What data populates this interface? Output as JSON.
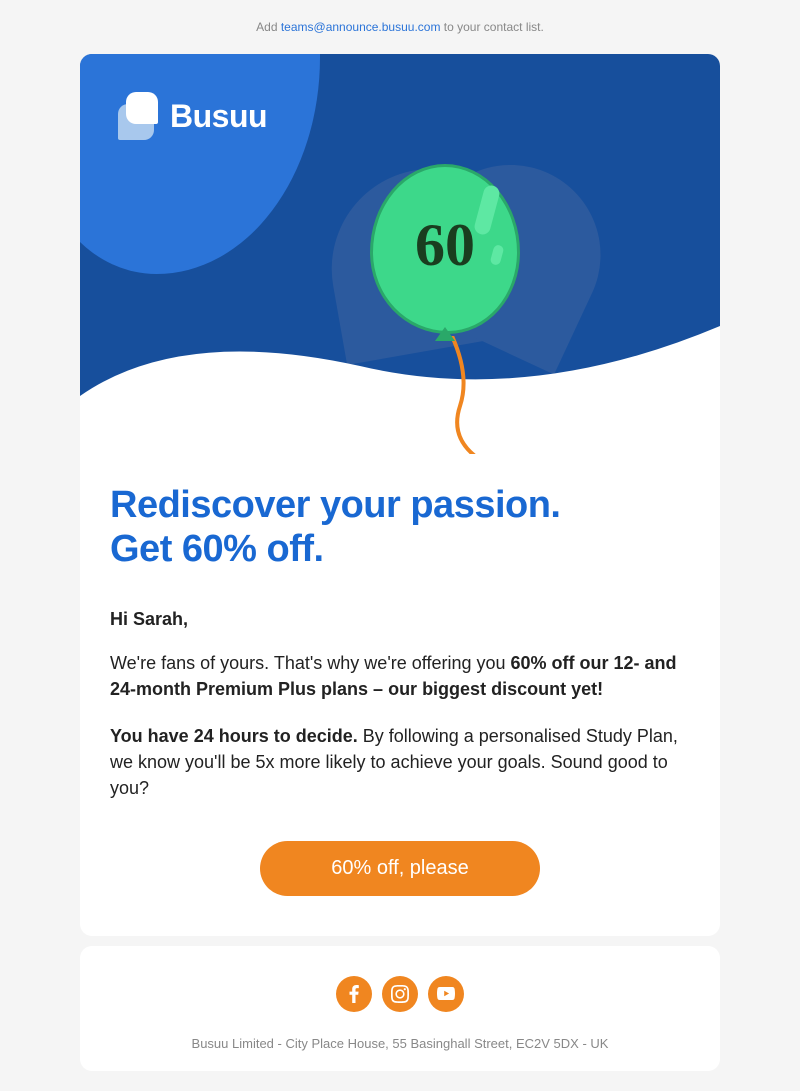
{
  "notice": {
    "prefix": "Add ",
    "email": "teams@announce.busuu.com",
    "suffix": " to your contact list."
  },
  "logo": {
    "name": "Busuu"
  },
  "balloon": {
    "number": "60"
  },
  "headline": {
    "line1": "Rediscover your passion.",
    "line2": "Get 60% off."
  },
  "greeting": "Hi Sarah,",
  "paragraphs": {
    "p1_prefix": "We're fans of yours. That's why we're offering you ",
    "p1_bold": "60% off our 12- and 24-month Premium Plus plans – our biggest discount yet!",
    "p2_bold": "You have 24 hours to decide.",
    "p2_suffix": " By following a personalised Study Plan, we know you'll be 5x more likely to achieve your goals. Sound good to you?"
  },
  "cta": {
    "label": "60% off, please"
  },
  "footer": {
    "address": "Busuu Limited - City Place House, 55 Basinghall Street, EC2V 5DX - UK"
  },
  "colors": {
    "primary_blue": "#1968d2",
    "dark_blue": "#174f9c",
    "mid_blue": "#2b74d8",
    "orange": "#f08620",
    "green": "#3dd88a"
  }
}
